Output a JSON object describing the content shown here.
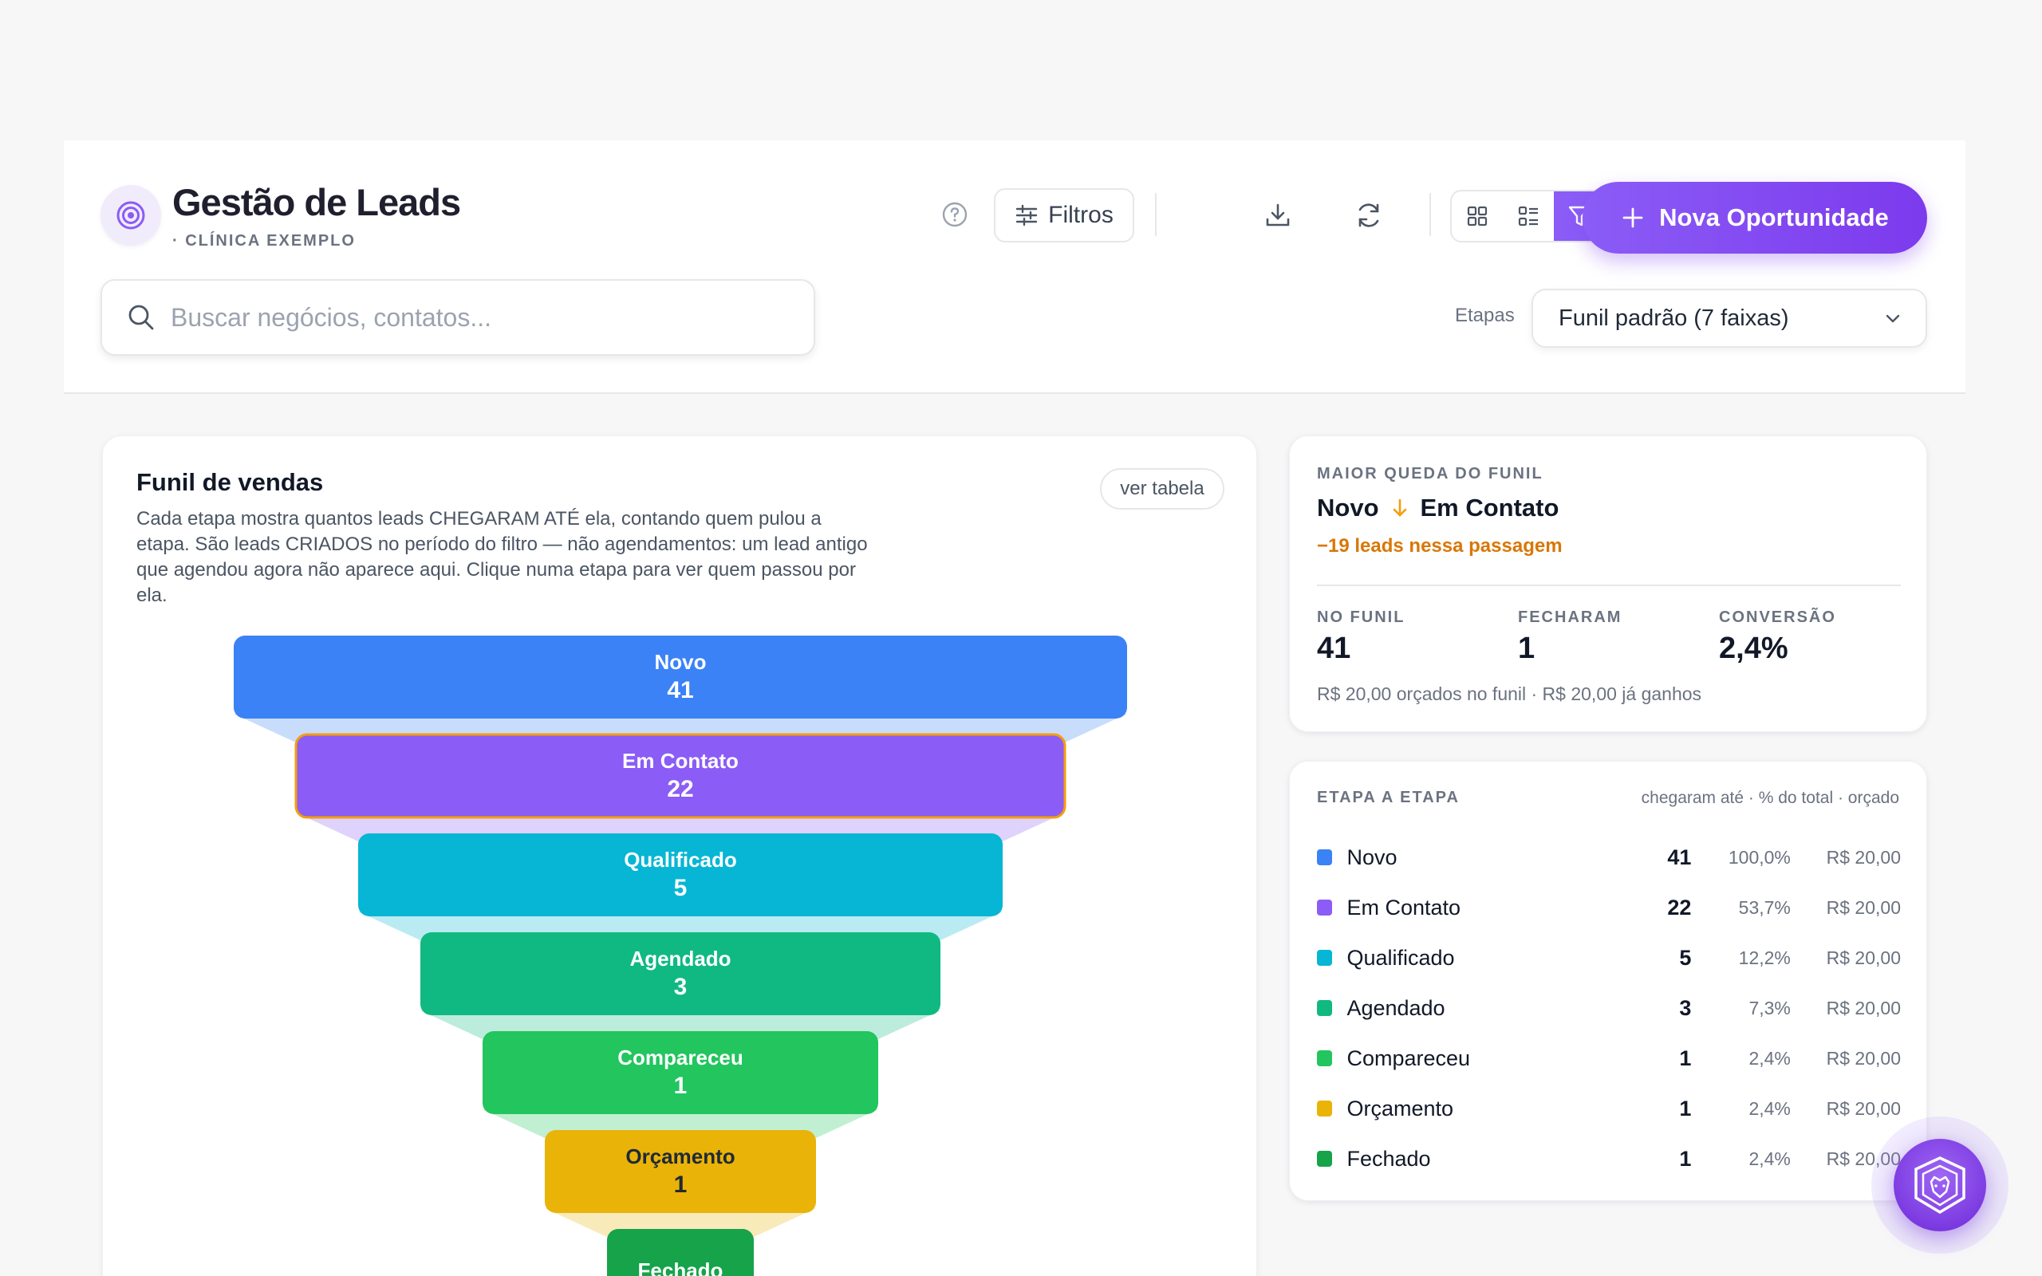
{
  "header": {
    "title": "Gestão de Leads",
    "subtitle": "· CLÍNICA EXEMPLO",
    "filters_label": "Filtros",
    "new_opportunity_label": "Nova Oportunidade",
    "search_placeholder": "Buscar negócios, contatos...",
    "stages_label": "Etapas",
    "stages_selected": "Funil padrão (7 faixas)"
  },
  "funnel": {
    "title": "Funil de vendas",
    "description": "Cada etapa mostra quantos leads CHEGARAM ATÉ ela, contando quem pulou a etapa. São leads CRIADOS no período do filtro — não agendamentos: um lead antigo que agendou agora não aparece aqui. Clique numa etapa para ver quem passou por ela.",
    "table_button": "ver tabela",
    "stages": [
      {
        "name": "Novo",
        "count": "41",
        "color": "#3b82f6"
      },
      {
        "name": "Em Contato",
        "count": "22",
        "color": "#8b5cf6"
      },
      {
        "name": "Qualificado",
        "count": "5",
        "color": "#06b6d4"
      },
      {
        "name": "Agendado",
        "count": "3",
        "color": "#10b981"
      },
      {
        "name": "Compareceu",
        "count": "1",
        "color": "#22c55e"
      },
      {
        "name": "Orçamento",
        "count": "1",
        "color": "#eab308"
      },
      {
        "name": "Fechado",
        "count": "",
        "color": "#16a34a"
      }
    ]
  },
  "biggest_drop": {
    "label": "MAIOR QUEDA DO FUNIL",
    "from": "Novo",
    "to": "Em Contato",
    "loss": "−19 leads nessa passagem",
    "stats": [
      {
        "label": "NO FUNIL",
        "value": "41"
      },
      {
        "label": "FECHARAM",
        "value": "1"
      },
      {
        "label": "CONVERSÃO",
        "value": "2,4%"
      }
    ],
    "footer": "R$ 20,00 orçados no funil · R$ 20,00 já ganhos"
  },
  "step_by_step": {
    "label": "ETAPA A ETAPA",
    "legend": "chegaram até · % do total · orçado",
    "rows": [
      {
        "name": "Novo",
        "count": "41",
        "pct": "100,0%",
        "amount": "R$ 20,00",
        "color": "#3b82f6"
      },
      {
        "name": "Em Contato",
        "count": "22",
        "pct": "53,7%",
        "amount": "R$ 20,00",
        "color": "#8b5cf6"
      },
      {
        "name": "Qualificado",
        "count": "5",
        "pct": "12,2%",
        "amount": "R$ 20,00",
        "color": "#06b6d4"
      },
      {
        "name": "Agendado",
        "count": "3",
        "pct": "7,3%",
        "amount": "R$ 20,00",
        "color": "#10b981"
      },
      {
        "name": "Compareceu",
        "count": "1",
        "pct": "2,4%",
        "amount": "R$ 20,00",
        "color": "#22c55e"
      },
      {
        "name": "Orçamento",
        "count": "1",
        "pct": "2,4%",
        "amount": "R$ 20,00",
        "color": "#eab308"
      },
      {
        "name": "Fechado",
        "count": "1",
        "pct": "2,4%",
        "amount": "R$ 20,00",
        "color": "#16a34a"
      }
    ]
  }
}
